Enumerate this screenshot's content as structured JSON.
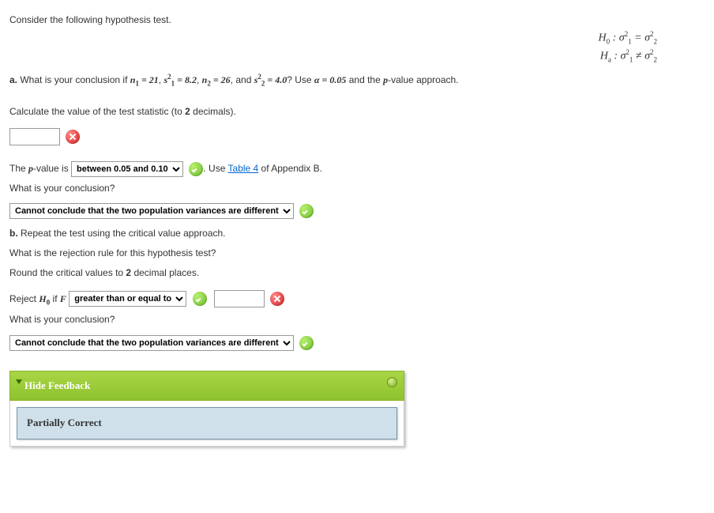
{
  "intro": "Consider the following hypothesis test.",
  "hypothesis": {
    "h0_label": "H",
    "h0_sub": "0",
    "h0_body": " :  σ",
    "eq": " = ",
    "neq": " ≠ ",
    "ha_label": "H",
    "ha_sub": "a",
    "sigma_sub1": "1",
    "sigma_sub2": "2",
    "sigma_sup": "2"
  },
  "partA": {
    "label": "a.",
    "prefix": " What is your conclusion if ",
    "n1": "21",
    "s1": "8.2",
    "n2": "26",
    "s2": "4.0",
    "use_text": "? Use ",
    "alpha": "0.05",
    "suffix": " and the ",
    "pval": "p",
    "approach": "-value approach."
  },
  "calc_line": "Calculate the value of the test statistic (to ",
  "two": "2",
  "decimals_text": " decimals).",
  "pvalue_line_prefix": "The ",
  "pvalue_line_mid": "-value is ",
  "pvalue_select": "between 0.05 and 0.10",
  "table_text1": ". Use ",
  "table_link": "Table 4",
  "table_text2": " of Appendix B.",
  "conclusion_q": "What is your conclusion?",
  "conclusion_select": "Cannot conclude that the two population variances are different",
  "partB": {
    "label": "b.",
    "text": " Repeat the test using the critical value approach."
  },
  "rejection_q": "What is the rejection rule for this hypothesis test?",
  "round_text1": "Round the critical values to ",
  "round_text2": " decimal places.",
  "reject_prefix": "Reject ",
  "reject_if": " if ",
  "reject_select": "greater than or equal to",
  "feedback": {
    "header": "Hide Feedback",
    "body": "Partially Correct"
  }
}
